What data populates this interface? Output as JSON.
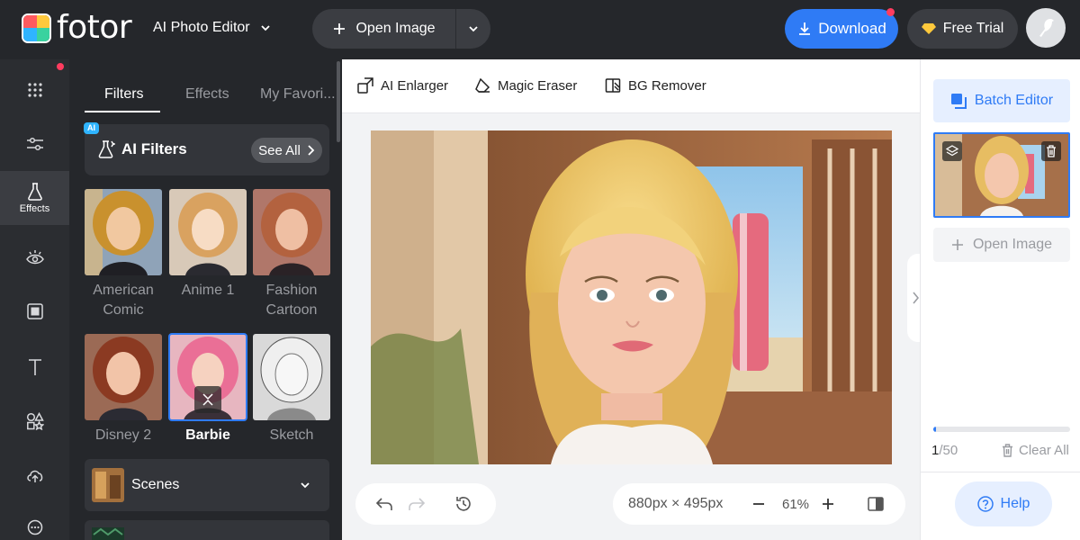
{
  "header": {
    "brand": "fotor",
    "app_menu_label": "AI Photo Editor",
    "open_image_label": "Open Image",
    "download_label": "Download",
    "free_trial_label": "Free Trial",
    "colors": {
      "bar": "#25272b",
      "accent": "#2f7bf5",
      "notify": "#ff3c5f"
    }
  },
  "rail": {
    "items": [
      {
        "icon": "apps-grid-icon"
      },
      {
        "icon": "adjust-sliders-icon"
      },
      {
        "icon": "flask-icon",
        "label": "Effects"
      },
      {
        "icon": "eye-icon"
      },
      {
        "icon": "frame-icon"
      },
      {
        "icon": "text-icon"
      },
      {
        "icon": "elements-icon"
      },
      {
        "icon": "cloud-upload-icon"
      },
      {
        "icon": "more-icon"
      }
    ]
  },
  "panel": {
    "tabs": [
      "Filters",
      "Effects",
      "My Favori..."
    ],
    "ai_badge": "AI",
    "ai_filters_title": "AI Filters",
    "see_all_label": "See All",
    "filters": [
      {
        "label": "American Comic"
      },
      {
        "label": "Anime 1"
      },
      {
        "label": "Fashion Cartoon"
      },
      {
        "label": "Disney 2"
      },
      {
        "label": "Barbie",
        "selected": true
      },
      {
        "label": "Sketch"
      }
    ],
    "scenes_label": "Scenes"
  },
  "toolbar": {
    "tools": [
      "AI Enlarger",
      "Magic Eraser",
      "BG Remover"
    ]
  },
  "canvas": {
    "dimensions": "880px × 495px",
    "zoom": "61%"
  },
  "right_panel": {
    "batch_editor_label": "Batch Editor",
    "open_image_label": "Open Image",
    "count_current": "1",
    "count_total": "/50",
    "progress_fraction": 0.02,
    "clear_all_label": "Clear All",
    "help_label": "Help"
  }
}
